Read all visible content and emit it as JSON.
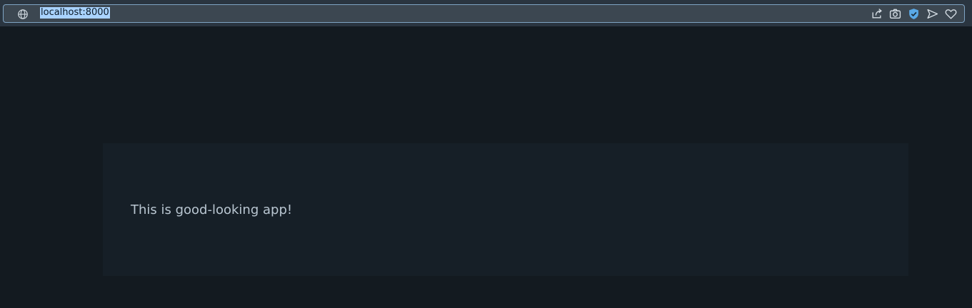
{
  "browser": {
    "url": "localhost:8000",
    "url_icon": "globe-icon",
    "actions": [
      "share-icon",
      "camera-icon",
      "shield-check-icon",
      "send-icon",
      "heart-icon"
    ],
    "colors": {
      "toolbar": "#2a3540",
      "url_field": "#3c4751",
      "url_border": "#7fa4c4",
      "selection": "#a9d3ff",
      "shield": "#5aa9e6"
    }
  },
  "page": {
    "background": "#131a20",
    "card": {
      "background": "#161f27",
      "text": "This is good-looking app!"
    }
  }
}
